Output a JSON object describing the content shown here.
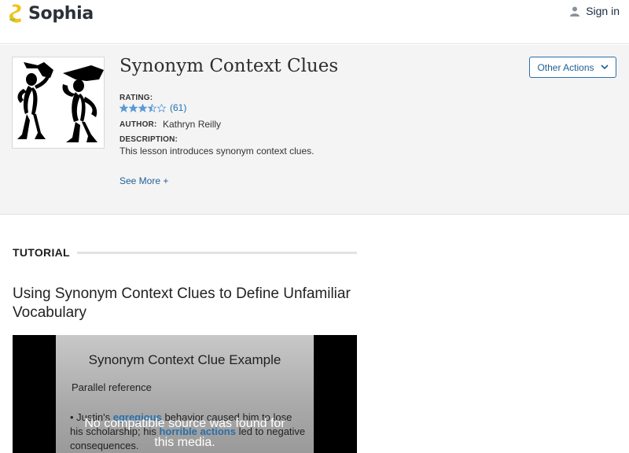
{
  "header": {
    "logo_text": "Sophia",
    "signin_label": "Sign in",
    "brand_color": "#f2c318"
  },
  "lesson": {
    "title": "Synonym Context Clues",
    "rating_label": "RATING:",
    "rating_value": 3.5,
    "rating_max": 5,
    "rating_count": "(61)",
    "author_label": "AUTHOR:",
    "author_name": "Kathryn Reilly",
    "description_label": "DESCRIPTION:",
    "description": "This lesson introduces synonym context clues.",
    "see_more": "See More +",
    "other_actions": "Other Actions"
  },
  "tutorial": {
    "heading": "TUTORIAL",
    "section_title": "Using Synonym Context Clues to Define Unfamiliar Vocabulary"
  },
  "video": {
    "slide_title": "Synonym Context Clue Example",
    "slide_sub": "Parallel reference",
    "bullet_pre": "• Justin's ",
    "bullet_word": "egregious",
    "bullet_mid": " behavior caused him to lose his scholarship; his ",
    "bullet_word2": "horrible actions",
    "bullet_post": " led to negative consequences.",
    "overlay_message": "No compatible source was found for this media."
  },
  "colors": {
    "link": "#1f6fb0",
    "star": "#5b9bd5"
  },
  "icons": {
    "logo": "sophia-logo-icon",
    "user": "user-icon",
    "chevron": "chevron-down-icon",
    "star": "star-icon"
  }
}
